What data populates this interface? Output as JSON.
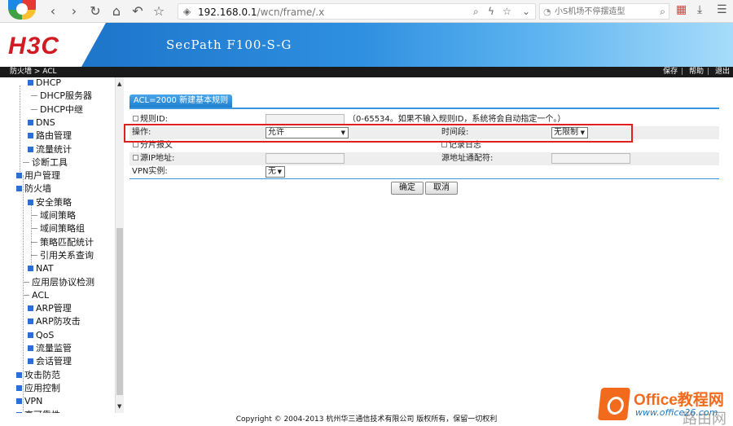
{
  "browser": {
    "url_host": "192.168.0.1",
    "url_path": "/wcn/frame/.x",
    "search_placeholder": "小S机场不停摆造型"
  },
  "header": {
    "brand": "H3C",
    "model": "SecPath F100-S-G"
  },
  "strip": {
    "breadcrumb": "防火墙 > ACL",
    "save": "保存",
    "help": "帮助",
    "logout": "退出"
  },
  "sidebar": {
    "items": [
      "DHCP",
      "DHCP服务器",
      "DHCP中继",
      "DNS",
      "路由管理",
      "流量统计",
      "诊断工具",
      "用户管理",
      "防火墙",
      "安全策略",
      "域间策略",
      "域间策略组",
      "策略匹配统计",
      "引用关系查询",
      "NAT",
      "应用层协议检测",
      "ACL",
      "ARP管理",
      "ARP防攻击",
      "QoS",
      "流量监管",
      "会话管理",
      "攻击防范",
      "应用控制",
      "VPN",
      "高可靠性"
    ]
  },
  "form": {
    "tab_label": "ACL=2000 新建基本规则",
    "rule_id_label": "规则ID:",
    "rule_id_hint": "（0-65534。如果不输入规则ID，系统将会自动指定一个。）",
    "action_label": "操作:",
    "action_value": "允许",
    "time_range_label": "时间段:",
    "time_range_value": "无限制",
    "fragment_label": "分片报文",
    "log_label": "记录日志",
    "src_ip_label": "源IP地址:",
    "src_wildcard_label": "源地址通配符:",
    "vpn_label": "VPN实例:",
    "vpn_value": "无",
    "ok_button": "确定",
    "cancel_button": "取消"
  },
  "footer": {
    "copyright": "Copyright © 2004-2013 杭州华三通信技术有限公司 版权所有，保留一切权利"
  },
  "watermark": {
    "title": "Office教程网",
    "site": "www.office26.com",
    "extra": "路由网"
  },
  "colors": {
    "brand_red": "#d11b23",
    "header_blue": "#1f77cc",
    "highlight_red": "#e02020",
    "tree_box": "#2b6fd6"
  }
}
